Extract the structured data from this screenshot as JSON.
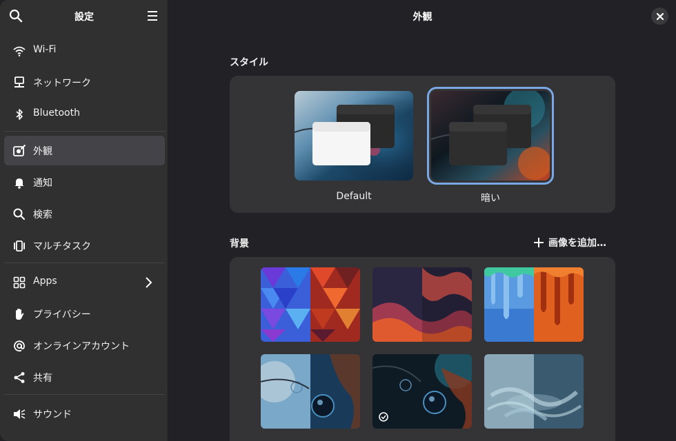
{
  "sidebar": {
    "title": "設定",
    "items": [
      {
        "label": "Wi-Fi",
        "icon": "wifi-icon"
      },
      {
        "label": "ネットワーク",
        "icon": "network-icon"
      },
      {
        "label": "Bluetooth",
        "icon": "bluetooth-icon"
      },
      {
        "label": "外観",
        "icon": "appearance-icon",
        "active": true
      },
      {
        "label": "通知",
        "icon": "bell-icon"
      },
      {
        "label": "検索",
        "icon": "search-icon"
      },
      {
        "label": "マルチタスク",
        "icon": "multitasking-icon"
      },
      {
        "label": "Apps",
        "icon": "apps-icon"
      },
      {
        "label": "プライバシー",
        "icon": "hand-icon"
      },
      {
        "label": "オンラインアカウント",
        "icon": "at-icon"
      },
      {
        "label": "共有",
        "icon": "share-icon"
      },
      {
        "label": "サウンド",
        "icon": "speaker-icon"
      }
    ]
  },
  "main": {
    "title": "外観",
    "style_section": {
      "label": "スタイル",
      "options": [
        {
          "label": "Default",
          "selected": false
        },
        {
          "label": "暗い",
          "selected": true
        }
      ]
    },
    "background_section": {
      "label": "背景",
      "add_label": "画像を追加…"
    }
  },
  "colors": {
    "accent": "#79a8e4",
    "sidebar_bg": "#303030",
    "main_bg": "#222226",
    "panel_bg": "#343437"
  }
}
